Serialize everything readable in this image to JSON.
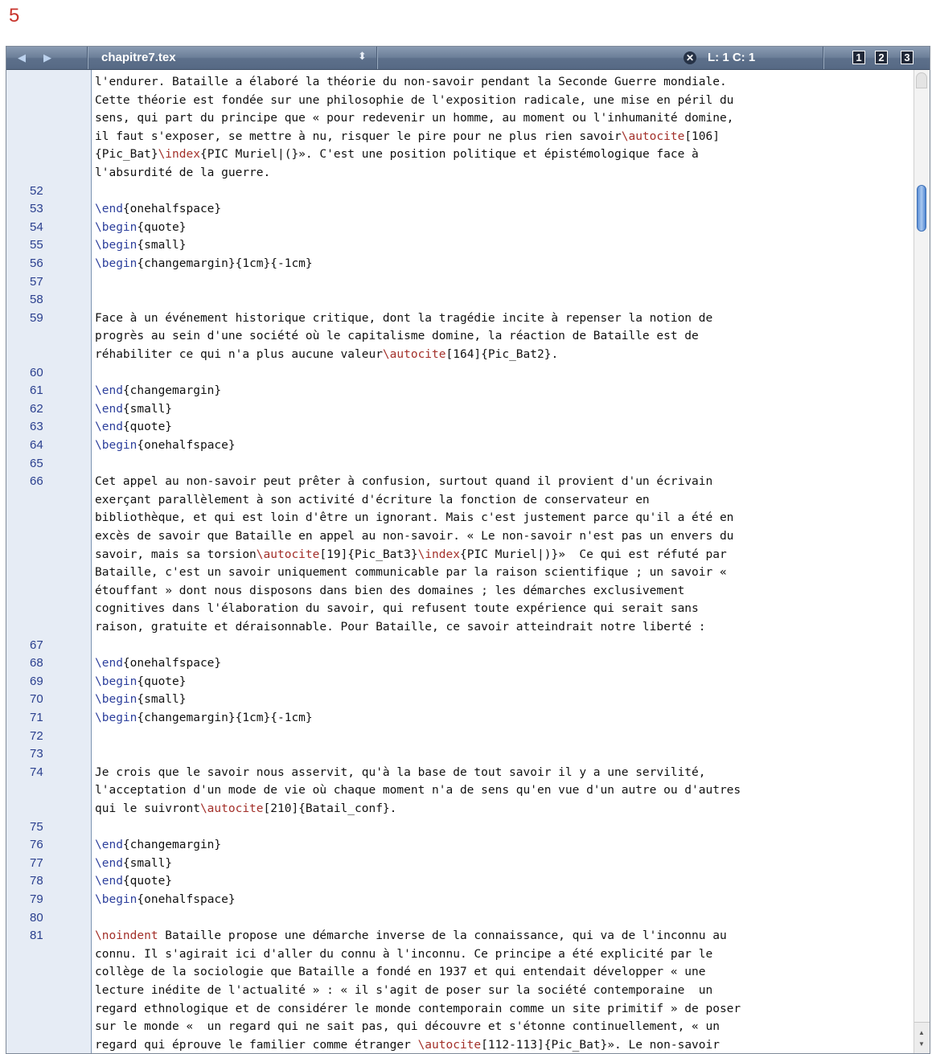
{
  "figure_number": "5",
  "toolbar": {
    "back_glyph": "◀",
    "forward_glyph": "▶",
    "file_name": "chapitre7.tex",
    "file_menu_glyph": "⬍",
    "close_glyph": "✕",
    "position": "L: 1 C: 1",
    "split_buttons": [
      "1",
      "2",
      "3"
    ]
  },
  "gutter": {
    "line_numbers": [
      {
        "n": "52",
        "row": 6
      },
      {
        "n": "53",
        "row": 7
      },
      {
        "n": "54",
        "row": 8
      },
      {
        "n": "55",
        "row": 9
      },
      {
        "n": "56",
        "row": 10
      },
      {
        "n": "57",
        "row": 11
      },
      {
        "n": "58",
        "row": 12
      },
      {
        "n": "59",
        "row": 13
      },
      {
        "n": "60",
        "row": 16
      },
      {
        "n": "61",
        "row": 17
      },
      {
        "n": "62",
        "row": 18
      },
      {
        "n": "63",
        "row": 19
      },
      {
        "n": "64",
        "row": 20
      },
      {
        "n": "65",
        "row": 21
      },
      {
        "n": "66",
        "row": 22
      },
      {
        "n": "67",
        "row": 31
      },
      {
        "n": "68",
        "row": 32
      },
      {
        "n": "69",
        "row": 33
      },
      {
        "n": "70",
        "row": 34
      },
      {
        "n": "71",
        "row": 35
      },
      {
        "n": "72",
        "row": 36
      },
      {
        "n": "73",
        "row": 37
      },
      {
        "n": "74",
        "row": 38
      },
      {
        "n": "75",
        "row": 41
      },
      {
        "n": "76",
        "row": 42
      },
      {
        "n": "77",
        "row": 43
      },
      {
        "n": "78",
        "row": 44
      },
      {
        "n": "79",
        "row": 45
      },
      {
        "n": "80",
        "row": 46
      },
      {
        "n": "81",
        "row": 47
      }
    ]
  },
  "editor": {
    "lines": [
      [
        {
          "t": "l'endurer. Bataille a élaboré la théorie du non-savoir pendant la Seconde Guerre mondiale."
        }
      ],
      [
        {
          "t": "Cette théorie est fondée sur une philosophie de l'exposition radicale, une mise en péril du"
        }
      ],
      [
        {
          "t": "sens, qui part du principe que « pour redevenir un homme, au moment ou l'inhumanité domine,"
        }
      ],
      [
        {
          "t": "il faut s'exposer, se mettre à nu, risquer le pire pour ne plus rien savoir"
        },
        {
          "t": "\\autocite",
          "c": "cmd"
        },
        {
          "t": "[106]"
        }
      ],
      [
        {
          "t": "{Pic_Bat}"
        },
        {
          "t": "\\index",
          "c": "cmd"
        },
        {
          "t": "{PIC Muriel|(}». C'est une position politique et épistémologique face à"
        }
      ],
      [
        {
          "t": "l'absurdité de la guerre."
        }
      ],
      [
        {
          "t": ""
        }
      ],
      [
        {
          "t": "\\end",
          "c": "kw"
        },
        {
          "t": "{onehalfspace}"
        }
      ],
      [
        {
          "t": "\\begin",
          "c": "kw"
        },
        {
          "t": "{quote}"
        }
      ],
      [
        {
          "t": "\\begin",
          "c": "kw"
        },
        {
          "t": "{small}"
        }
      ],
      [
        {
          "t": "\\begin",
          "c": "kw"
        },
        {
          "t": "{changemargin}{1cm}{-1cm}"
        }
      ],
      [
        {
          "t": ""
        }
      ],
      [
        {
          "t": ""
        }
      ],
      [
        {
          "t": "Face à un événement historique critique, dont la tragédie incite à repenser la notion de"
        }
      ],
      [
        {
          "t": "progrès au sein d'une société où le capitalisme domine, la réaction de Bataille est de"
        }
      ],
      [
        {
          "t": "réhabiliter ce qui n'a plus aucune valeur"
        },
        {
          "t": "\\autocite",
          "c": "cmd"
        },
        {
          "t": "[164]{Pic_Bat2}."
        }
      ],
      [
        {
          "t": ""
        }
      ],
      [
        {
          "t": "\\end",
          "c": "kw"
        },
        {
          "t": "{changemargin}"
        }
      ],
      [
        {
          "t": "\\end",
          "c": "kw"
        },
        {
          "t": "{small}"
        }
      ],
      [
        {
          "t": "\\end",
          "c": "kw"
        },
        {
          "t": "{quote}"
        }
      ],
      [
        {
          "t": "\\begin",
          "c": "kw"
        },
        {
          "t": "{onehalfspace}"
        }
      ],
      [
        {
          "t": ""
        }
      ],
      [
        {
          "t": "Cet appel au non-savoir peut prêter à confusion, surtout quand il provient d'un écrivain"
        }
      ],
      [
        {
          "t": "exerçant parallèlement à son activité d'écriture la fonction de conservateur en"
        }
      ],
      [
        {
          "t": "bibliothèque, et qui est loin d'être un ignorant. Mais c'est justement parce qu'il a été en"
        }
      ],
      [
        {
          "t": "excès de savoir que Bataille en appel au non-savoir. « Le non-savoir n'est pas un envers du"
        }
      ],
      [
        {
          "t": "savoir, mais sa torsion"
        },
        {
          "t": "\\autocite",
          "c": "cmd"
        },
        {
          "t": "[19]{Pic_Bat3}"
        },
        {
          "t": "\\index",
          "c": "cmd"
        },
        {
          "t": "{PIC Muriel|)}»  Ce qui est réfuté par"
        }
      ],
      [
        {
          "t": "Bataille, c'est un savoir uniquement communicable par la raison scientifique ; un savoir «"
        }
      ],
      [
        {
          "t": "étouffant » dont nous disposons dans bien des domaines ; les démarches exclusivement"
        }
      ],
      [
        {
          "t": "cognitives dans l'élaboration du savoir, qui refusent toute expérience qui serait sans"
        }
      ],
      [
        {
          "t": "raison, gratuite et déraisonnable. Pour Bataille, ce savoir atteindrait notre liberté :"
        }
      ],
      [
        {
          "t": ""
        }
      ],
      [
        {
          "t": "\\end",
          "c": "kw"
        },
        {
          "t": "{onehalfspace}"
        }
      ],
      [
        {
          "t": "\\begin",
          "c": "kw"
        },
        {
          "t": "{quote}"
        }
      ],
      [
        {
          "t": "\\begin",
          "c": "kw"
        },
        {
          "t": "{small}"
        }
      ],
      [
        {
          "t": "\\begin",
          "c": "kw"
        },
        {
          "t": "{changemargin}{1cm}{-1cm}"
        }
      ],
      [
        {
          "t": ""
        }
      ],
      [
        {
          "t": ""
        }
      ],
      [
        {
          "t": "Je crois que le savoir nous asservit, qu'à la base de tout savoir il y a une servilité,"
        }
      ],
      [
        {
          "t": "l'acceptation d'un mode de vie où chaque moment n'a de sens qu'en vue d'un autre ou d'autres"
        }
      ],
      [
        {
          "t": "qui le suivront"
        },
        {
          "t": "\\autocite",
          "c": "cmd"
        },
        {
          "t": "[210]{Batail_conf}."
        }
      ],
      [
        {
          "t": ""
        }
      ],
      [
        {
          "t": "\\end",
          "c": "kw"
        },
        {
          "t": "{changemargin}"
        }
      ],
      [
        {
          "t": "\\end",
          "c": "kw"
        },
        {
          "t": "{small}"
        }
      ],
      [
        {
          "t": "\\end",
          "c": "kw"
        },
        {
          "t": "{quote}"
        }
      ],
      [
        {
          "t": "\\begin",
          "c": "kw"
        },
        {
          "t": "{onehalfspace}"
        }
      ],
      [
        {
          "t": ""
        }
      ],
      [
        {
          "t": "\\noindent",
          "c": "cmd"
        },
        {
          "t": " Bataille propose une démarche inverse de la connaissance, qui va de l'inconnu au"
        }
      ],
      [
        {
          "t": "connu. Il s'agirait ici d'aller du connu à l'inconnu. Ce principe a été explicité par le"
        }
      ],
      [
        {
          "t": "collège de la sociologie que Bataille a fondé en 1937 et qui entendait développer « une"
        }
      ],
      [
        {
          "t": "lecture inédite de l'actualité » : « il s'agit de poser sur la société contemporaine  un"
        }
      ],
      [
        {
          "t": "regard ethnologique et de considérer le monde contemporain comme un site primitif » de poser"
        }
      ],
      [
        {
          "t": "sur le monde «  un regard qui ne sait pas, qui découvre et s'étonne continuellement, « un"
        }
      ],
      [
        {
          "t": "regard qui éprouve le familier comme étranger "
        },
        {
          "t": "\\autocite",
          "c": "cmd"
        },
        {
          "t": "[112-113]{Pic_Bat}». Le non-savoir"
        }
      ]
    ]
  },
  "scrollbar": {
    "up_glyph": "▲",
    "down_glyph": "▼"
  }
}
